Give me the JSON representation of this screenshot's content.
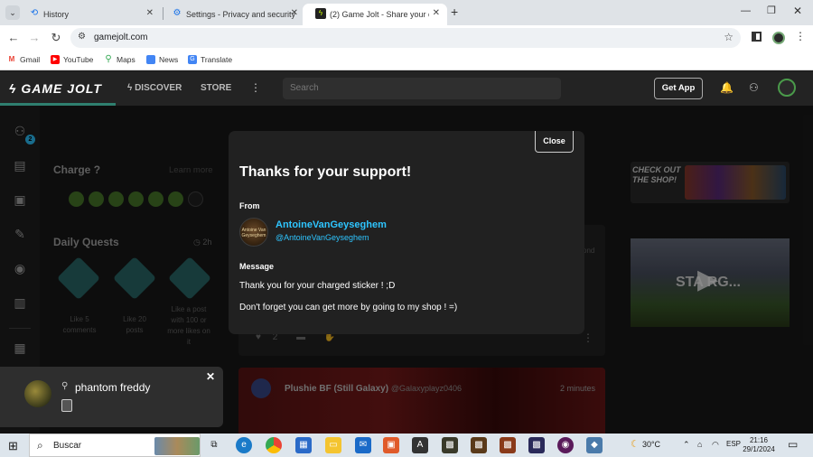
{
  "browser": {
    "tabs": [
      {
        "title": "History",
        "icon": "history-icon"
      },
      {
        "title": "Settings - Privacy and security",
        "icon": "gear-icon"
      },
      {
        "title": "(2) Game Jolt - Share your crea",
        "icon": "gamejolt-icon"
      }
    ],
    "url": "gamejolt.com",
    "bookmarks": [
      {
        "label": "Gmail",
        "color": "#ea4335"
      },
      {
        "label": "YouTube",
        "color": "#ff0000"
      },
      {
        "label": "Maps",
        "color": "#34a853"
      },
      {
        "label": "News",
        "color": "#4285f4"
      },
      {
        "label": "Translate",
        "color": "#4285f4"
      }
    ]
  },
  "gamejolt": {
    "logo": "GAME JOLT",
    "nav": {
      "discover": "DISCOVER",
      "store": "STORE"
    },
    "search_placeholder": "Search",
    "get_app": "Get App",
    "sidebar_badge": "2",
    "charge": {
      "title": "Charge",
      "learn_more": "Learn more"
    },
    "daily_quests": {
      "title": "Daily Quests",
      "timer": "2h",
      "quests": [
        "Like 5 comments",
        "Like 20 posts",
        "Like a post with 100 or more likes on it"
      ]
    },
    "feed": {
      "like_count": "2",
      "post_title": "Plushie BF (Still Galaxy)",
      "post_handle": "@Galaxyplayz0406",
      "post_time": "2 minutes",
      "side_text": "ond"
    },
    "shop_banner": "CHECK OUT THE SHOP!",
    "video_text": "STA RG..."
  },
  "modal": {
    "title": "Thanks for your support!",
    "close_label": "Close",
    "from_label": "From",
    "avatar_text": "Antoine Van Geyseghem",
    "user_name": "AntoineVanGeyseghem",
    "user_handle": "@AntoineVanGeyseghem",
    "message_label": "Message",
    "message_line1": "Thank you for your charged sticker ! ;D",
    "message_line2": "Don't forget you can get more by going to my shop ! =)"
  },
  "toast": {
    "name": "phantom freddy"
  },
  "taskbar": {
    "search_label": "Buscar",
    "temperature": "30°C",
    "language": "ESP",
    "time": "21:16",
    "date": "29/1/2024"
  }
}
